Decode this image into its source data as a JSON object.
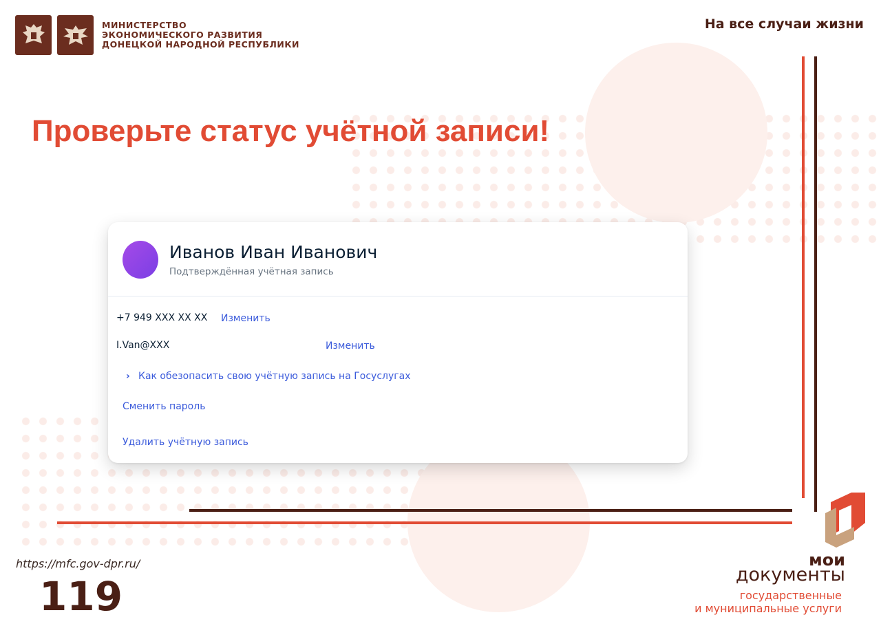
{
  "header": {
    "ministry_line1": "МИНИСТЕРСТВО",
    "ministry_line2": "ЭКОНОМИЧЕСКОГО РАЗВИТИЯ",
    "ministry_line3": "ДОНЕЦКОЙ НАРОДНОЙ РЕСПУБЛИКИ",
    "slogan": "На все случаи жизни",
    "emblems": [
      "russia-emblem-icon",
      "dpr-emblem-icon"
    ]
  },
  "title": "Проверьте статус учётной записи!",
  "profile": {
    "name": "Иванов Иван Иванович",
    "status": "Подтверждённая учётная запись",
    "avatar_color": "#9b45e8"
  },
  "contacts": {
    "phone": "+7 949 XXX XX XX",
    "phone_edit": "Изменить",
    "email": "I.Van@XXX",
    "email_edit": "Изменить"
  },
  "links": {
    "security": "Как обезопасить свою учётную запись на Госуслугах",
    "change_password": "Сменить пароль",
    "delete_account": "Удалить учётную запись"
  },
  "footer": {
    "url": "https://mfc.gov-dpr.ru/",
    "page_number": "119",
    "brand_line1": "мои",
    "brand_line2": "документы",
    "brand_line3": "государственные",
    "brand_line4": "и муниципальные услуги"
  },
  "colors": {
    "accent": "#e14b34",
    "brown": "#4a1f15",
    "link": "#3b5bdb"
  }
}
